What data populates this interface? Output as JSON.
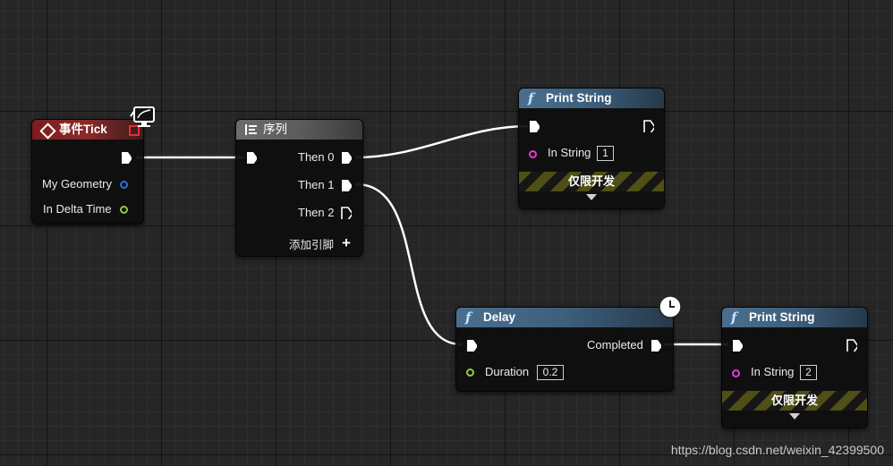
{
  "nodes": {
    "event_tick": {
      "title": "事件Tick",
      "pins": {
        "geometry": "My Geometry",
        "delta": "In Delta Time"
      }
    },
    "sequence": {
      "title": "序列",
      "outputs": [
        "Then 0",
        "Then 1",
        "Then 2"
      ],
      "add_pin": "添加引脚",
      "add_icon": "+"
    },
    "print1": {
      "title": "Print String",
      "in_string_label": "In String",
      "in_string_value": "1",
      "dev_only": "仅限开发"
    },
    "delay": {
      "title": "Delay",
      "completed": "Completed",
      "duration_label": "Duration",
      "duration_value": "0.2"
    },
    "print2": {
      "title": "Print String",
      "in_string_label": "In String",
      "in_string_value": "2",
      "dev_only": "仅限开发"
    }
  },
  "icons": {
    "function": "f",
    "event": "event-diamond-icon",
    "sequence": "sequence-icon",
    "clock": "clock-icon",
    "monitor": "monitor-icon"
  },
  "colors": {
    "exec_wire": "#ffffff",
    "geometry_pin": "#2f6fe0",
    "float_pin": "#8bd13a",
    "string_pin": "#e33ad6",
    "event_header": "#7c1c1e",
    "function_header": "#4a6f8e",
    "sequence_header": "#666666"
  },
  "watermark": "https://blog.csdn.net/weixin_42399500"
}
